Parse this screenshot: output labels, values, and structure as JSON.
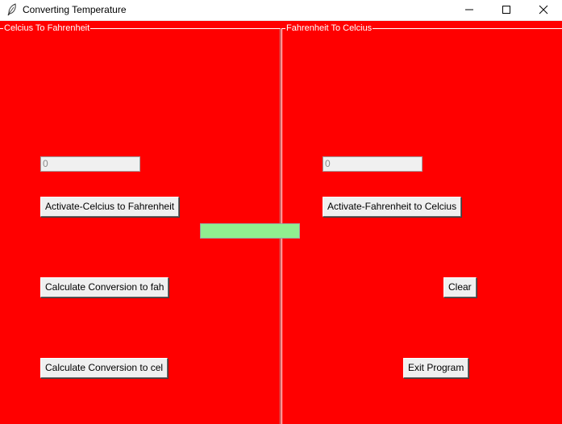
{
  "window": {
    "title": "Converting Temperature",
    "icon": "feather-icon"
  },
  "frames": {
    "left_label": "Celcius To Fahrenheit",
    "right_label": "Fahrenheit To Celcius"
  },
  "left": {
    "entry_value": "0",
    "activate_label": "Activate-Celcius to Fahrenheit",
    "calc_fah_label": "Calculate Conversion to fah",
    "calc_cel_label": "Calculate Conversion to cel"
  },
  "right": {
    "entry_value": "0",
    "activate_label": "Activate-Fahrenheit to Celcius",
    "clear_label": "Clear",
    "exit_label": "Exit Program"
  },
  "colors": {
    "background": "#ff0000",
    "result_field": "#90ee90"
  }
}
